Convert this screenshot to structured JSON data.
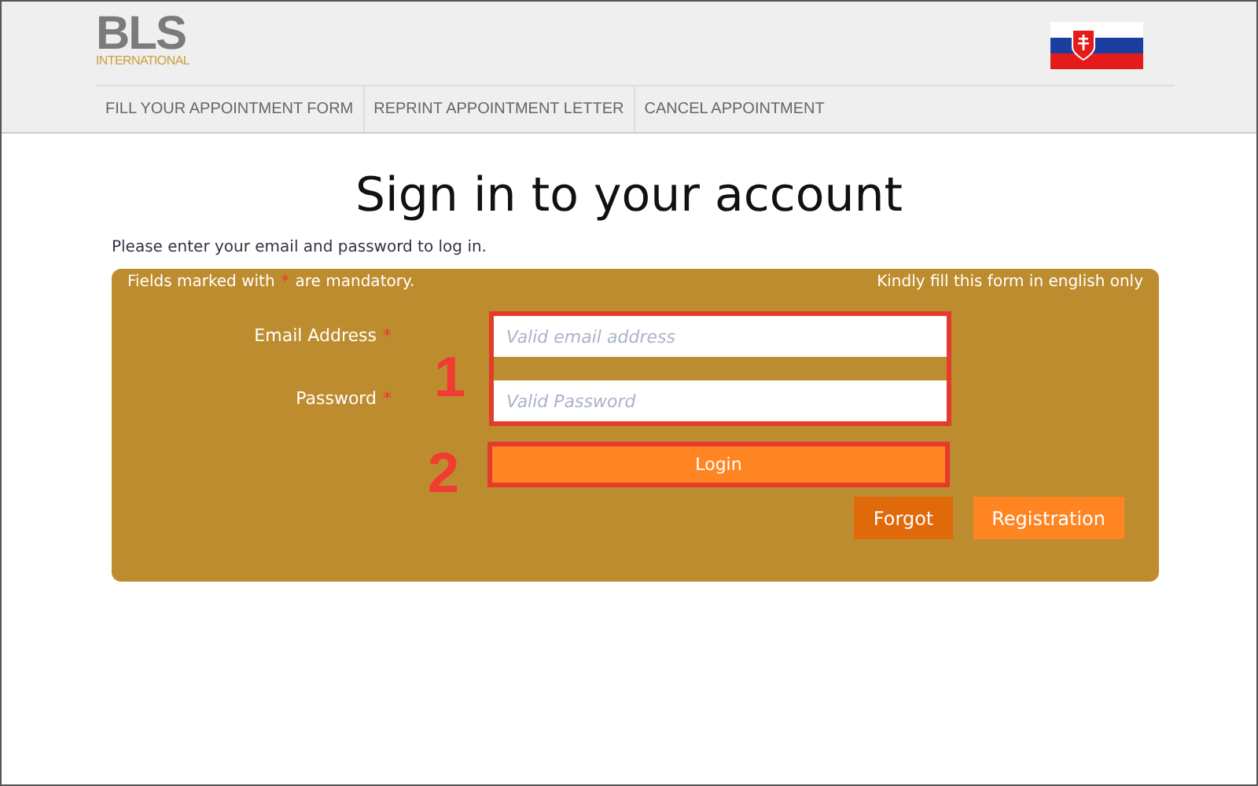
{
  "header": {
    "logo": {
      "name": "BLS",
      "subtitle": "INTERNATIONAL"
    },
    "nav": [
      {
        "label": "FILL YOUR APPOINTMENT FORM"
      },
      {
        "label": "REPRINT APPOINTMENT LETTER"
      },
      {
        "label": "CANCEL APPOINTMENT"
      }
    ]
  },
  "title": "Sign in to your account",
  "intro": "Please enter your email and password to log in.",
  "form": {
    "note_before": "Fields marked with",
    "required_mark": "*",
    "note_after": "are mandatory.",
    "note_right": "Kindly fill this form in english only",
    "fields": [
      {
        "label": "Email Address",
        "required": true,
        "placeholder": "Valid email address"
      },
      {
        "label": "Password",
        "required": true,
        "placeholder": "Valid Password"
      }
    ],
    "annotations": [
      "1",
      "2"
    ],
    "login": "Login",
    "buttons": [
      {
        "label": "Forgot",
        "kind": "dark"
      },
      {
        "label": "Registration",
        "kind": "light"
      }
    ]
  }
}
